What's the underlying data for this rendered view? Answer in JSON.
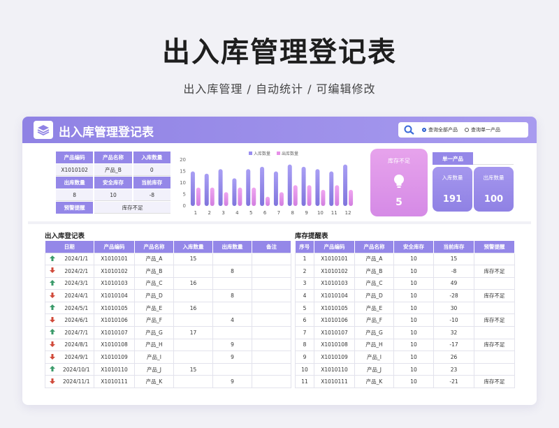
{
  "page": {
    "title": "出入库管理登记表",
    "subtitle": "出入库管理 / 自动统计 / 可编辑修改"
  },
  "header": {
    "title": "出入库管理登记表",
    "radio_all": "查询全部产品",
    "radio_single": "查询单一产品"
  },
  "info_grid": {
    "h1": "产品编码",
    "h2": "产品名称",
    "h3": "入库数量",
    "v1": "X1010102",
    "v2": "产品_B",
    "v3": "0",
    "h4": "出库数量",
    "h5": "安全库存",
    "h6": "当前库存",
    "v4": "8",
    "v5": "10",
    "v6": "-8",
    "h7": "预警提醒",
    "v7": "库存不足"
  },
  "chart_data": {
    "type": "bar",
    "categories": [
      "1",
      "2",
      "3",
      "4",
      "5",
      "6",
      "7",
      "8",
      "9",
      "10",
      "11",
      "12"
    ],
    "series": [
      {
        "name": "入库数量",
        "values": [
          15,
          14,
          16,
          12,
          16,
          17,
          15,
          18,
          17,
          16,
          15,
          18
        ]
      },
      {
        "name": "出库数量",
        "values": [
          8,
          8,
          6,
          8,
          8,
          4,
          6,
          9,
          9,
          7,
          9,
          7
        ]
      }
    ],
    "ylim": [
      0,
      20
    ],
    "yticks": [
      "0",
      "5",
      "10",
      "15",
      "20"
    ],
    "legend": "top-center",
    "colors": [
      "#9a8ef0",
      "#e790e8"
    ]
  },
  "stock_alert": {
    "label": "库存不足",
    "value": "5"
  },
  "single": {
    "label": "单一产品"
  },
  "stats": {
    "in_label": "入库数量",
    "in_value": "191",
    "out_label": "出库数量",
    "out_value": "100"
  },
  "ledger": {
    "title": "出入库登记表",
    "headers": [
      "日期",
      "产品编码",
      "产品名称",
      "入库数量",
      "出库数量",
      "备注"
    ],
    "rows": [
      {
        "dir": "in",
        "date": "2024/1/1",
        "code": "X1010101",
        "name": "产品_A",
        "in": "15",
        "out": ""
      },
      {
        "dir": "out",
        "date": "2024/2/1",
        "code": "X1010102",
        "name": "产品_B",
        "in": "",
        "out": "8"
      },
      {
        "dir": "in",
        "date": "2024/3/1",
        "code": "X1010103",
        "name": "产品_C",
        "in": "16",
        "out": ""
      },
      {
        "dir": "out",
        "date": "2024/4/1",
        "code": "X1010104",
        "name": "产品_D",
        "in": "",
        "out": "8"
      },
      {
        "dir": "in",
        "date": "2024/5/1",
        "code": "X1010105",
        "name": "产品_E",
        "in": "16",
        "out": ""
      },
      {
        "dir": "out",
        "date": "2024/6/1",
        "code": "X1010106",
        "name": "产品_F",
        "in": "",
        "out": "4"
      },
      {
        "dir": "in",
        "date": "2024/7/1",
        "code": "X1010107",
        "name": "产品_G",
        "in": "17",
        "out": ""
      },
      {
        "dir": "out",
        "date": "2024/8/1",
        "code": "X1010108",
        "name": "产品_H",
        "in": "",
        "out": "9"
      },
      {
        "dir": "out",
        "date": "2024/9/1",
        "code": "X1010109",
        "name": "产品_I",
        "in": "",
        "out": "9"
      },
      {
        "dir": "in",
        "date": "2024/10/1",
        "code": "X1010110",
        "name": "产品_J",
        "in": "15",
        "out": ""
      },
      {
        "dir": "out",
        "date": "2024/11/1",
        "code": "X1010111",
        "name": "产品_K",
        "in": "",
        "out": "9"
      }
    ]
  },
  "stock": {
    "title": "库存提醒表",
    "headers": [
      "序号",
      "产品编码",
      "产品名称",
      "安全库存",
      "当前库存",
      "预警提醒"
    ],
    "rows": [
      {
        "no": "1",
        "code": "X1010101",
        "name": "产品_A",
        "safe": "10",
        "cur": "15",
        "warn": ""
      },
      {
        "no": "2",
        "code": "X1010102",
        "name": "产品_B",
        "safe": "10",
        "cur": "-8",
        "warn": "库存不足"
      },
      {
        "no": "3",
        "code": "X1010103",
        "name": "产品_C",
        "safe": "10",
        "cur": "49",
        "warn": ""
      },
      {
        "no": "4",
        "code": "X1010104",
        "name": "产品_D",
        "safe": "10",
        "cur": "-28",
        "warn": "库存不足"
      },
      {
        "no": "5",
        "code": "X1010105",
        "name": "产品_E",
        "safe": "10",
        "cur": "30",
        "warn": ""
      },
      {
        "no": "6",
        "code": "X1010106",
        "name": "产品_F",
        "safe": "10",
        "cur": "-10",
        "warn": "库存不足"
      },
      {
        "no": "7",
        "code": "X1010107",
        "name": "产品_G",
        "safe": "10",
        "cur": "32",
        "warn": ""
      },
      {
        "no": "8",
        "code": "X1010108",
        "name": "产品_H",
        "safe": "10",
        "cur": "-17",
        "warn": "库存不足"
      },
      {
        "no": "9",
        "code": "X1010109",
        "name": "产品_I",
        "safe": "10",
        "cur": "26",
        "warn": ""
      },
      {
        "no": "10",
        "code": "X1010110",
        "name": "产品_J",
        "safe": "10",
        "cur": "23",
        "warn": ""
      },
      {
        "no": "11",
        "code": "X1010111",
        "name": "产品_K",
        "safe": "10",
        "cur": "-21",
        "warn": "库存不足"
      }
    ]
  },
  "colors": {
    "accent": "#9487e8",
    "in_arrow": "#3a9a6a",
    "out_arrow": "#d04a3a",
    "pink": "#d58ae6"
  }
}
